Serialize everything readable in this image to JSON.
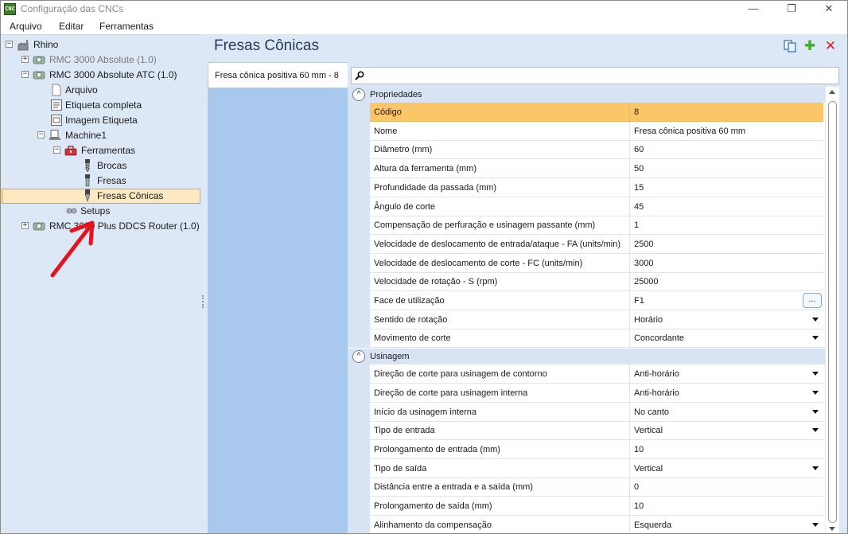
{
  "window": {
    "title": "Configuração das CNCs",
    "app_icon_text": "CNC",
    "minimize": "—",
    "maximize": "❐",
    "close": "✕"
  },
  "menubar": {
    "items": [
      "Arquivo",
      "Editar",
      "Ferramentas"
    ]
  },
  "tree": {
    "root": "Rhino",
    "machine_1": "RMC 3000 Absolute (1.0)",
    "machine_2": "RMC 3000 Absolute ATC (1.0)",
    "arquivo": "Arquivo",
    "etiqueta_completa": "Etiqueta completa",
    "imagem_etiqueta": "Imagem Etiqueta",
    "machine1": "Machine1",
    "ferramentas": "Ferramentas",
    "brocas": "Brocas",
    "fresas": "Fresas",
    "fresas_conicas": "Fresas Cônicas",
    "setups": "Setups",
    "machine_3": "RMC 3000 Plus DDCS Router (1.0)",
    "selected": "Fresas Cônicas",
    "expanders": {
      "collapsed": "+",
      "expanded": "−"
    }
  },
  "page": {
    "title": "Fresas Cônicas"
  },
  "toolbar": {
    "copy_icon": "copy-icon",
    "add_icon": "add-icon",
    "delete_icon": "delete-icon",
    "add_glyph": "✚",
    "delete_glyph": "✕"
  },
  "tool_list": {
    "items": [
      "Fresa cônica positiva 60 mm - 8"
    ]
  },
  "search": {
    "value": "",
    "placeholder": ""
  },
  "sections": [
    {
      "title": "Propriedades",
      "rows": [
        {
          "name": "Código",
          "value": "8"
        },
        {
          "name": "Nome",
          "value": "Fresa cônica positiva 60 mm"
        },
        {
          "name": "Diâmetro (mm)",
          "value": "60"
        },
        {
          "name": "Altura da ferramenta (mm)",
          "value": "50"
        },
        {
          "name": "Profundidade da passada (mm)",
          "value": "15"
        },
        {
          "name": "Ângulo de corte",
          "value": "45"
        },
        {
          "name": "Compensação de perfuração e usinagem passante (mm)",
          "value": "1"
        },
        {
          "name": "Velocidade de deslocamento de entrada/ataque - FA (units/min)",
          "value": "2500"
        },
        {
          "name": "Velocidade de deslocamento de corte - FC (units/min)",
          "value": "3000"
        },
        {
          "name": "Velocidade de rotação - S (rpm)",
          "value": "25000"
        },
        {
          "name": "Face de utilização",
          "value": "F1",
          "button": "..."
        },
        {
          "name": "Sentido de rotação",
          "value": "Horário"
        },
        {
          "name": "Movimento de corte",
          "value": "Concordante"
        }
      ]
    },
    {
      "title": "Usinagem",
      "rows": [
        {
          "name": "Direção de corte para usinagem de contorno",
          "value": "Anti-horário"
        },
        {
          "name": "Direção de corte para usinagem interna",
          "value": "Anti-horário"
        },
        {
          "name": "Início da usinagem interna",
          "value": "No canto"
        },
        {
          "name": "Tipo de entrada",
          "value": "Vertical"
        },
        {
          "name": "Prolongamento de entrada (mm)",
          "value": "10"
        },
        {
          "name": "Tipo de saída",
          "value": "Vertical"
        },
        {
          "name": "Distância entre a entrada e a saída (mm)",
          "value": "0"
        },
        {
          "name": "Prolongamento de saída (mm)",
          "value": "10"
        },
        {
          "name": "Alinhamento da compensação",
          "value": "Esquerda"
        }
      ]
    }
  ],
  "colors": {
    "highlight": "#fbc56a",
    "panel": "#dde8f6",
    "list": "#a9c8ee",
    "tree_selection": "#fde9c1",
    "annotation": "#e8121e",
    "add": "#3fae1f",
    "delete": "#e02020"
  },
  "collapse_glyph": "^"
}
